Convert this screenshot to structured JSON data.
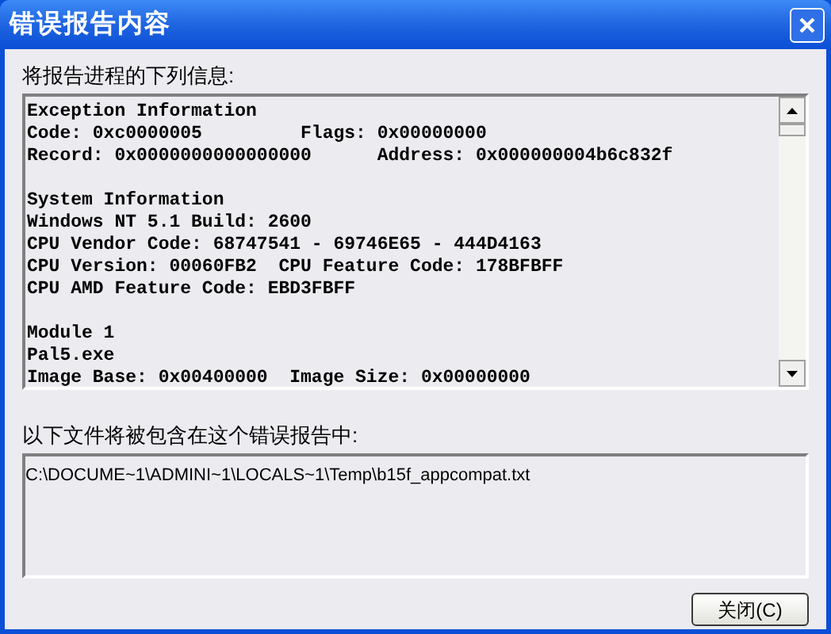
{
  "window": {
    "title": "错误报告内容"
  },
  "report": {
    "label": "将报告进程的下列信息:",
    "sections": [
      [
        "Exception Information",
        "Code: 0xc0000005         Flags: 0x00000000",
        "Record: 0x0000000000000000      Address: 0x000000004b6c832f"
      ],
      [
        "System Information",
        "Windows NT 5.1 Build: 2600",
        "CPU Vendor Code: 68747541 - 69746E65 - 444D4163",
        "CPU Version: 00060FB2  CPU Feature Code: 178BFBFF",
        "CPU AMD Feature Code: EBD3FBFF"
      ],
      [
        "Module 1",
        "Pal5.exe",
        "Image Base: 0x00400000  Image Size: 0x00000000"
      ]
    ]
  },
  "files": {
    "label": "以下文件将被包含在这个错误报告中:",
    "items": [
      "C:\\DOCUME~1\\ADMINI~1\\LOCALS~1\\Temp\\b15f_appcompat.txt"
    ]
  },
  "buttons": [
    {
      "label": "关闭(C)"
    }
  ]
}
